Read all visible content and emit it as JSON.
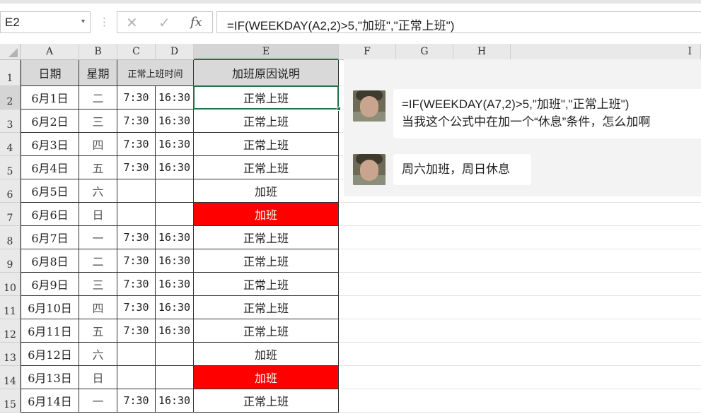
{
  "formula_bar": {
    "name_box": "E2",
    "name_box_arrow": "▾",
    "separator_icon": "⋮",
    "cancel_icon": "✕",
    "enter_icon": "✓",
    "fx_label": "fx",
    "formula": "=IF(WEEKDAY(A2,2)>5,\"加班\",\"正常上班\")"
  },
  "columns": [
    "A",
    "B",
    "C",
    "D",
    "E",
    "F",
    "G",
    "H",
    "I"
  ],
  "rows": [
    "1",
    "2",
    "3",
    "4",
    "5",
    "6",
    "7",
    "8",
    "9",
    "10",
    "11",
    "12",
    "13",
    "14",
    "15"
  ],
  "table": {
    "headers": [
      "日期",
      "星期",
      "正常上班时间",
      "加班原因说明"
    ],
    "rows": [
      {
        "date": "6月1日",
        "weekday": "二",
        "start": "7:30",
        "end": "16:30",
        "reason": "正常上班",
        "highlight": false
      },
      {
        "date": "6月2日",
        "weekday": "三",
        "start": "7:30",
        "end": "16:30",
        "reason": "正常上班",
        "highlight": false
      },
      {
        "date": "6月3日",
        "weekday": "四",
        "start": "7:30",
        "end": "16:30",
        "reason": "正常上班",
        "highlight": false
      },
      {
        "date": "6月4日",
        "weekday": "五",
        "start": "7:30",
        "end": "16:30",
        "reason": "正常上班",
        "highlight": false
      },
      {
        "date": "6月5日",
        "weekday": "六",
        "start": "",
        "end": "",
        "reason": "加班",
        "highlight": false
      },
      {
        "date": "6月6日",
        "weekday": "日",
        "start": "",
        "end": "",
        "reason": "加班",
        "highlight": true
      },
      {
        "date": "6月7日",
        "weekday": "一",
        "start": "7:30",
        "end": "16:30",
        "reason": "正常上班",
        "highlight": false
      },
      {
        "date": "6月8日",
        "weekday": "二",
        "start": "7:30",
        "end": "16:30",
        "reason": "正常上班",
        "highlight": false
      },
      {
        "date": "6月9日",
        "weekday": "三",
        "start": "7:30",
        "end": "16:30",
        "reason": "正常上班",
        "highlight": false
      },
      {
        "date": "6月10日",
        "weekday": "四",
        "start": "7:30",
        "end": "16:30",
        "reason": "正常上班",
        "highlight": false
      },
      {
        "date": "6月11日",
        "weekday": "五",
        "start": "7:30",
        "end": "16:30",
        "reason": "正常上班",
        "highlight": false
      },
      {
        "date": "6月12日",
        "weekday": "六",
        "start": "",
        "end": "",
        "reason": "加班",
        "highlight": false
      },
      {
        "date": "6月13日",
        "weekday": "日",
        "start": "",
        "end": "",
        "reason": "加班",
        "highlight": true
      },
      {
        "date": "6月14日",
        "weekday": "一",
        "start": "7:30",
        "end": "16:30",
        "reason": "正常上班",
        "highlight": false
      }
    ]
  },
  "chat": {
    "messages": [
      {
        "line1": "=IF(WEEKDAY(A7,2)>5,\"加班\",\"正常上班\")",
        "line2": "当我这个公式中在加一个“休息”条件，怎么加啊"
      },
      {
        "line1": "周六加班，周日休息"
      }
    ]
  },
  "colors": {
    "highlight": "#ff0000",
    "selection": "#217346",
    "header_fill": "#d9d9d9",
    "chat_background": "#f3f3f3"
  }
}
